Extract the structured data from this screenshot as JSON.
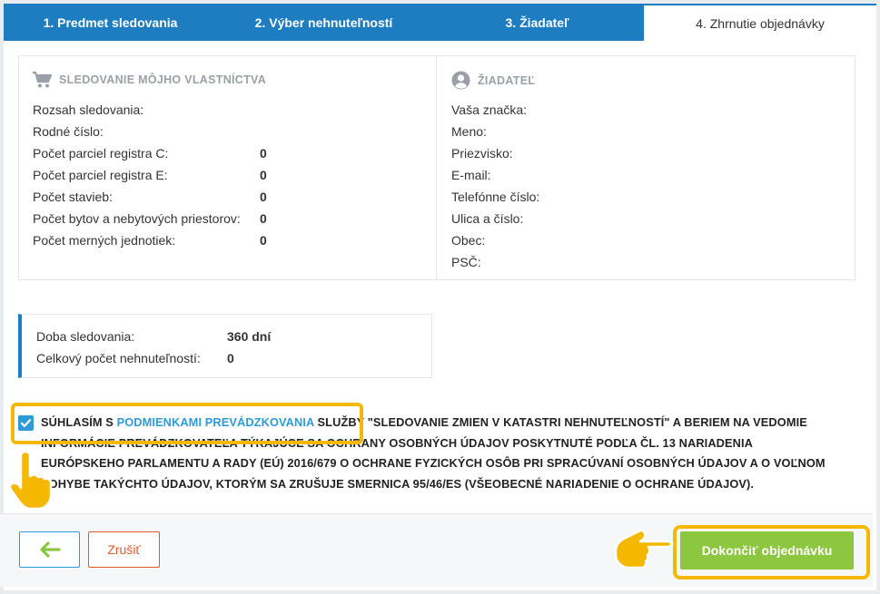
{
  "tabs": [
    {
      "label": "1. Predmet sledovania"
    },
    {
      "label": "2. Výber nehnuteľností"
    },
    {
      "label": "3. Žiadateľ"
    },
    {
      "label": "4. Zhrnutie objednávky"
    }
  ],
  "monitoring": {
    "heading": "SLEDOVANIE MÔJHO VLASTNÍCTVA",
    "icon": "cart-icon",
    "rows": [
      {
        "label": "Rozsah sledovania:",
        "value": ""
      },
      {
        "label": "Rodné číslo:",
        "value": ""
      },
      {
        "label": "Počet parciel registra C:",
        "value": "0"
      },
      {
        "label": "Počet parciel registra E:",
        "value": "0"
      },
      {
        "label": "Počet stavieb:",
        "value": "0"
      },
      {
        "label": "Počet bytov a nebytových priestorov:",
        "value": "0"
      },
      {
        "label": "Počet merných jednotiek:",
        "value": "0"
      }
    ]
  },
  "applicant": {
    "heading": "ŽIADATEĽ",
    "icon": "user-circle-icon",
    "rows": [
      {
        "label": "Vaša značka:"
      },
      {
        "label": "Meno:"
      },
      {
        "label": "Priezvisko:"
      },
      {
        "label": "E-mail:"
      },
      {
        "label": "Telefónne číslo:"
      },
      {
        "label": "Ulica a číslo:"
      },
      {
        "label": "Obec:"
      },
      {
        "label": "PSČ:"
      }
    ]
  },
  "summary": {
    "duration_label": "Doba sledovania:",
    "duration_value": "360 dní",
    "count_label": "Celkový počet nehnuteľností:",
    "count_value": "0"
  },
  "consent": {
    "checked": true,
    "prefix": "Súhlasím s ",
    "link": "podmienkami prevádzkovania",
    "suffix": " služby \"Sledovanie zmien v katastri nehnuteľností\" a beriem na vedomie informácie prevádzkovateľa týkajúce sa ochrany osobných údajov poskytnuté podľa čl. 13 Nariadenia Európskeho parlamentu a rady (EÚ) 2016/679 o ochrane fyzických osôb pri spracúvaní osobných údajov a o voľnom pohybe takýchto údajov, ktorým sa zrušuje smernica 95/46/ES (všeobecné nariadenie o ochrane údajov)."
  },
  "footer": {
    "back_icon": "arrow-left-icon",
    "cancel_label": "Zrušiť",
    "finish_label": "Dokončiť objednávku"
  },
  "colors": {
    "primary": "#1d7dc0",
    "link": "#2e9ad6",
    "success": "#8dc63f",
    "danger": "#e05a2b",
    "highlight": "#f5b800"
  }
}
